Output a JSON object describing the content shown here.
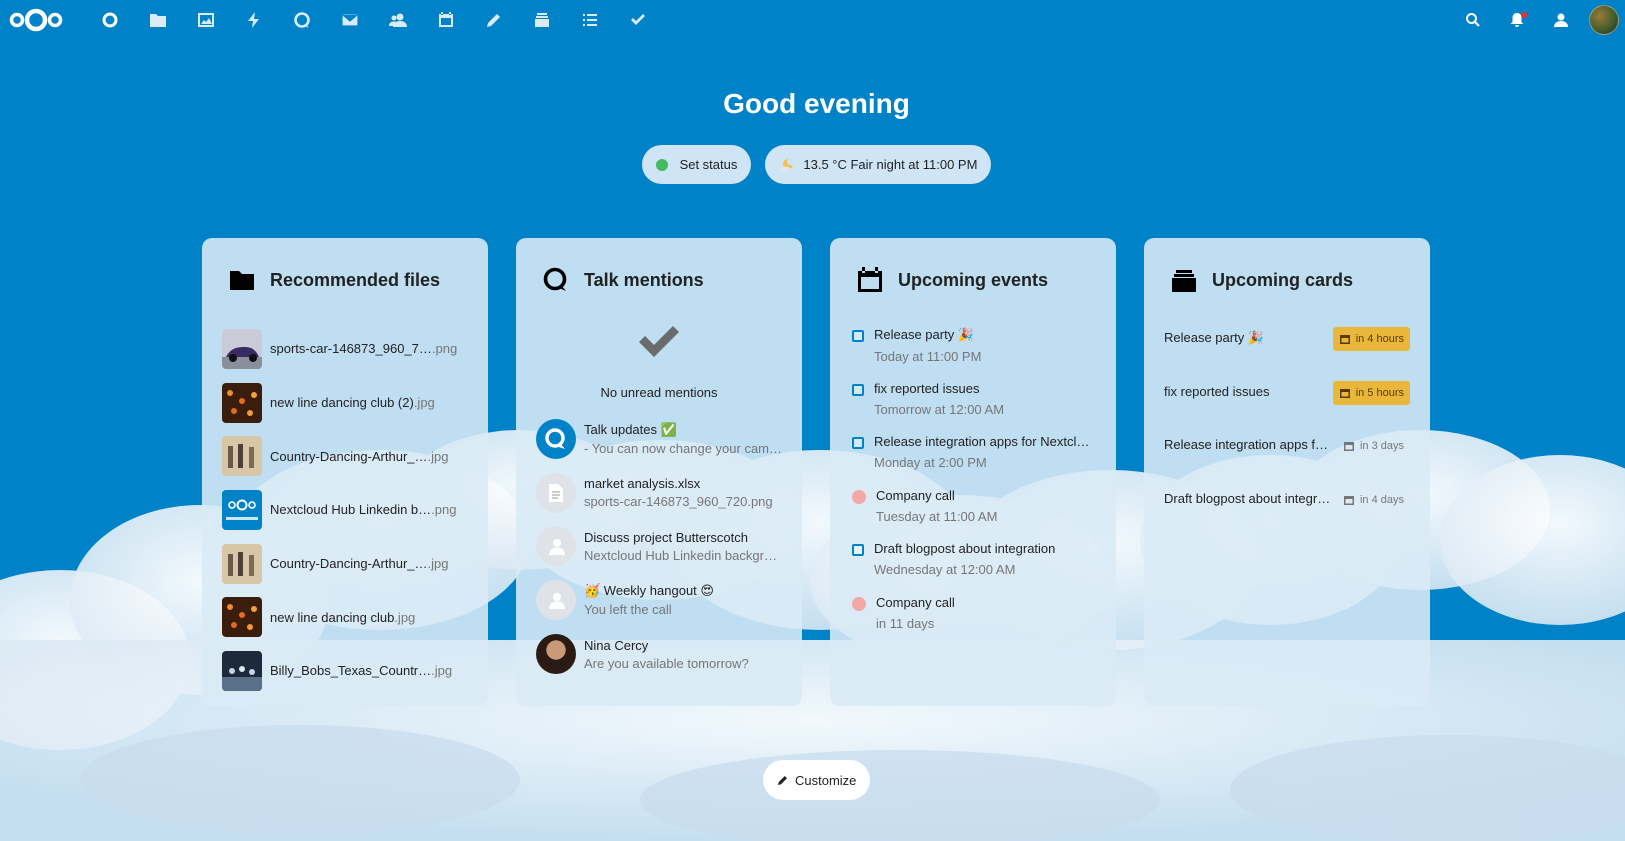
{
  "colors": {
    "brand": "#0082c9",
    "status_online": "#46ba61",
    "due_soon": "#e9b83a"
  },
  "topbar": {
    "apps": [
      {
        "name": "dashboard-app",
        "icon": "circle-icon",
        "active": true
      },
      {
        "name": "files-app",
        "icon": "folder-icon"
      },
      {
        "name": "photos-app",
        "icon": "image-icon"
      },
      {
        "name": "activity-app",
        "icon": "lightning-icon"
      },
      {
        "name": "talk-app",
        "icon": "talk-icon"
      },
      {
        "name": "mail-app",
        "icon": "mail-icon"
      },
      {
        "name": "contacts-app",
        "icon": "contacts-icon"
      },
      {
        "name": "calendar-app",
        "icon": "calendar-icon"
      },
      {
        "name": "notes-app",
        "icon": "pencil-icon"
      },
      {
        "name": "deck-app",
        "icon": "deck-icon"
      },
      {
        "name": "tasks-app",
        "icon": "list-icon"
      },
      {
        "name": "checkmark-app",
        "icon": "checkmark-icon"
      }
    ],
    "right": [
      "search-icon",
      "notifications-icon",
      "contacts-menu-icon",
      "user-avatar"
    ]
  },
  "greeting": "Good evening",
  "status": {
    "label": "Set status"
  },
  "weather": {
    "label": "13.5 °C Fair night at 11:00 PM",
    "icon": "moon-cloud-icon"
  },
  "recommended_files": {
    "title": "Recommended files",
    "items": [
      {
        "name": "sports-car-146873_960_7…",
        "ext": ".png",
        "thumb": "car"
      },
      {
        "name": "new line dancing club (2)",
        "ext": ".jpg",
        "thumb": "club"
      },
      {
        "name": "Country-Dancing-Arthur_…",
        "ext": ".jpg",
        "thumb": "country"
      },
      {
        "name": "Nextcloud Hub Linkedin b…",
        "ext": ".png",
        "thumb": "nextcloud"
      },
      {
        "name": "Country-Dancing-Arthur_…",
        "ext": ".jpg",
        "thumb": "country"
      },
      {
        "name": "new line dancing club",
        "ext": ".jpg",
        "thumb": "club"
      },
      {
        "name": "Billy_Bobs_Texas_Countr…",
        "ext": ".jpg",
        "thumb": "texas"
      }
    ]
  },
  "talk_mentions": {
    "title": "Talk mentions",
    "empty_text": "No unread mentions",
    "items": [
      {
        "title": "Talk updates ✅",
        "sub": "- You can now change your camera…",
        "avatar": "talk"
      },
      {
        "title": "market analysis.xlsx",
        "sub": "sports-car-146873_960_720.png",
        "avatar": "file"
      },
      {
        "title": "Discuss project Butterscotch",
        "sub": "Nextcloud Hub Linkedin background…",
        "avatar": "group"
      },
      {
        "title": "🥳 Weekly hangout 😍",
        "sub": "You left the call",
        "avatar": "group"
      },
      {
        "title": "Nina Cercy",
        "sub": "Are you available tomorrow?",
        "avatar": "person"
      }
    ]
  },
  "upcoming_events": {
    "title": "Upcoming events",
    "items": [
      {
        "title": "Release party 🎉",
        "sub": "Today at 11:00 PM",
        "kind": "task"
      },
      {
        "title": "fix reported issues",
        "sub": "Tomorrow at 12:00 AM",
        "kind": "task"
      },
      {
        "title": "Release integration apps for Nextcloud Hub",
        "sub": "Monday at 2:00 PM",
        "kind": "task"
      },
      {
        "title": "Company call",
        "sub": "Tuesday at 11:00 AM",
        "kind": "event"
      },
      {
        "title": "Draft blogpost about integration",
        "sub": "Wednesday at 12:00 AM",
        "kind": "task"
      },
      {
        "title": "Company call",
        "sub": "in 11 days",
        "kind": "event"
      }
    ]
  },
  "upcoming_cards": {
    "title": "Upcoming cards",
    "items": [
      {
        "title": "Release party 🎉",
        "due": "in 4 hours",
        "soon": true
      },
      {
        "title": "fix reported issues",
        "due": "in 5 hours",
        "soon": true
      },
      {
        "title": "Release integration apps for Nextcloud Hub",
        "due": "in 3 days",
        "soon": false
      },
      {
        "title": "Draft blogpost about integrations",
        "due": "in 4 days",
        "soon": false
      }
    ]
  },
  "customize": {
    "label": "Customize"
  }
}
